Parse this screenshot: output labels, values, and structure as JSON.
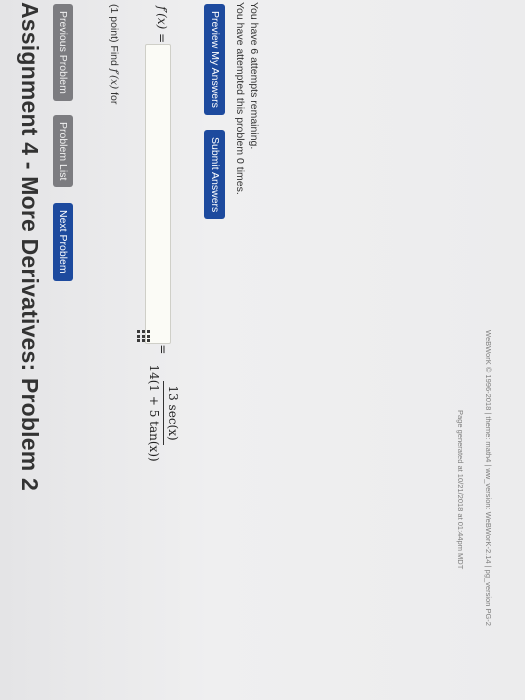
{
  "assignment": {
    "title": "Assignment 4 - More Derivatives: Problem 2"
  },
  "nav": {
    "previous_label": "Previous Problem",
    "list_label": "Problem List",
    "next_label": "Next Problem"
  },
  "problem": {
    "prompt_prefix": "(1 point) Find ",
    "prompt_math": "f′(x)",
    "prompt_suffix": " for",
    "function_lhs": "f(x) =",
    "numerator": "13 sec(x)",
    "denominator": "14(1 + 5 tan(x))"
  },
  "answer": {
    "label": "f′(x) =",
    "value": ""
  },
  "actions": {
    "preview_label": "Preview My Answers",
    "submit_label": "Submit Answers"
  },
  "status": {
    "attempted": "You have attempted this problem 0 times.",
    "remaining": "You have 6 attempts remaining."
  },
  "footer": {
    "generated": "Page generated at 10/21/2018 at 01:44pm MDT",
    "copyright": "WeBWorK © 1996-2018 | theme: math4 | ww_version: WeBWorK-2.14 | pg_version PG-2"
  },
  "icons": {
    "keypad": "keypad-grid-icon"
  },
  "colors": {
    "nav_button": "#7c7c80",
    "primary_button": "#1d4a9e",
    "background": "#ececed"
  }
}
